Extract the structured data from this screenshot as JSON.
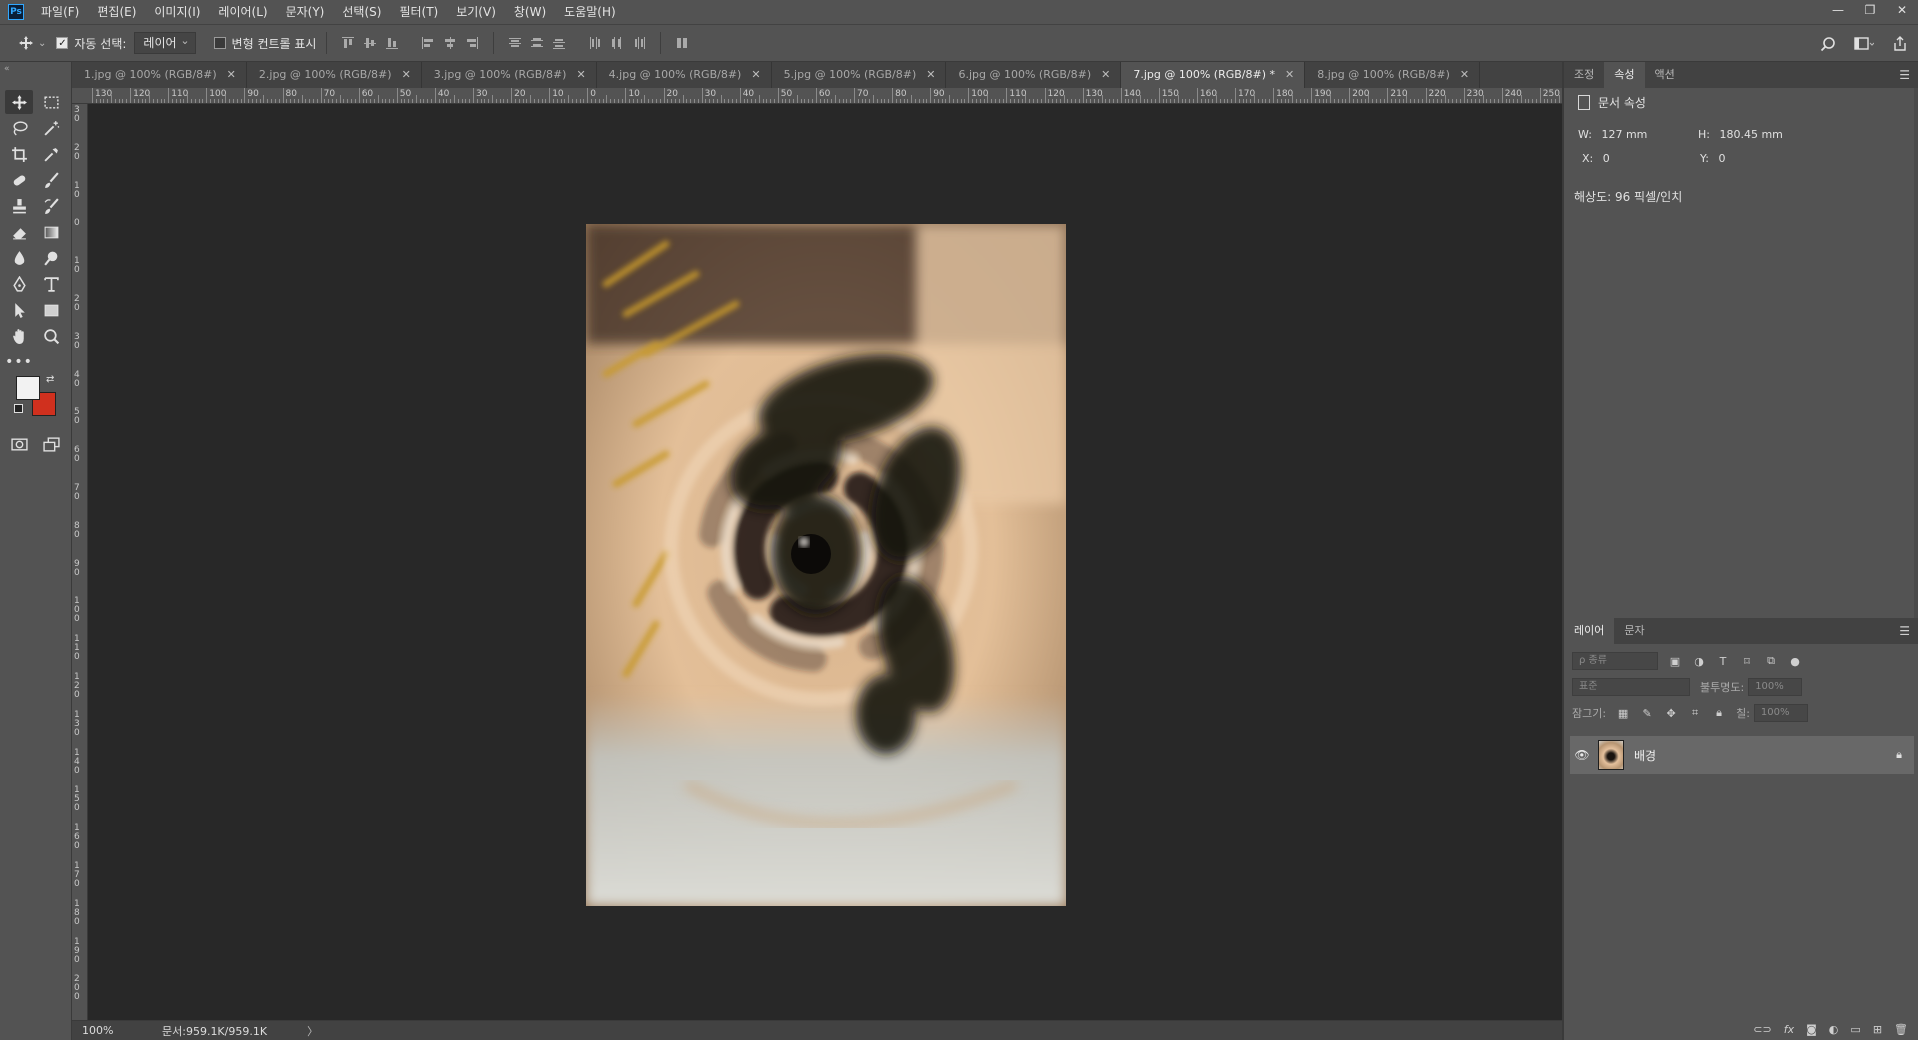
{
  "app": {
    "logo": "Ps"
  },
  "menubar": {
    "items": [
      "파일(F)",
      "편집(E)",
      "이미지(I)",
      "레이어(L)",
      "문자(Y)",
      "선택(S)",
      "필터(T)",
      "보기(V)",
      "창(W)",
      "도움말(H)"
    ]
  },
  "window_controls": {
    "minimize": "—",
    "restore": "❐",
    "close": "✕"
  },
  "options": {
    "auto_select_label": "자동 선택:",
    "auto_select_value": "레이어",
    "transform_controls_label": "변형 컨트롤 표시"
  },
  "tabs": [
    {
      "label": "1.jpg @ 100% (RGB/8#)"
    },
    {
      "label": "2.jpg @ 100% (RGB/8#)"
    },
    {
      "label": "3.jpg @ 100% (RGB/8#)"
    },
    {
      "label": "4.jpg @ 100% (RGB/8#)"
    },
    {
      "label": "5.jpg @ 100% (RGB/8#)"
    },
    {
      "label": "6.jpg @ 100% (RGB/8#)"
    },
    {
      "label": "7.jpg @ 100% (RGB/8#) *",
      "active": true
    },
    {
      "label": "8.jpg @ 100% (RGB/8#)"
    }
  ],
  "ruler_h_labels": [
    "130",
    "120",
    "110",
    "100",
    "90",
    "80",
    "70",
    "60",
    "50",
    "40",
    "30",
    "20",
    "10",
    "0",
    "10",
    "20",
    "30",
    "40",
    "50",
    "60",
    "70",
    "80",
    "90",
    "100",
    "110",
    "120",
    "130",
    "140",
    "150",
    "160",
    "170",
    "180",
    "190",
    "200",
    "210",
    "220",
    "230",
    "240",
    "250"
  ],
  "ruler_v_labels": [
    "3\n0",
    "2\n0",
    "1\n0",
    "0",
    "1\n0",
    "2\n0",
    "3\n0",
    "4\n0",
    "5\n0",
    "6\n0",
    "7\n0",
    "8\n0",
    "9\n0",
    "1\n0\n0",
    "1\n1\n0",
    "1\n2\n0",
    "1\n3\n0",
    "1\n4\n0",
    "1\n5\n0",
    "1\n6\n0",
    "1\n7\n0",
    "1\n8\n0",
    "1\n9\n0",
    "2\n0\n0"
  ],
  "status": {
    "zoom": "100%",
    "doc_size": "문서:959.1K/959.1K",
    "arrow": "〉"
  },
  "colors": {
    "foreground": "#f2f2f2",
    "background": "#d0301e",
    "accent": "#31a8ff"
  },
  "properties": {
    "tabs": [
      {
        "label": "조정"
      },
      {
        "label": "속성",
        "active": true
      },
      {
        "label": "액션"
      }
    ],
    "header": "문서 속성",
    "w_label": "W:",
    "w_value": "127 mm",
    "h_label": "H:",
    "h_value": "180.45 mm",
    "x_label": "X:",
    "x_value": "0",
    "y_label": "Y:",
    "y_value": "0",
    "resolution": "해상도: 96 픽셀/인치"
  },
  "layers": {
    "tabs": [
      {
        "label": "레이어",
        "active": true
      },
      {
        "label": "문자"
      }
    ],
    "filter_placeholder": "ρ 종류",
    "blend_mode": "표준",
    "opacity_label": "불투명도:",
    "opacity_value": "100%",
    "lock_label": "잠그기:",
    "fill_label": "칠:",
    "fill_value": "100%",
    "items": [
      {
        "name": "배경",
        "visible": true,
        "locked": true
      }
    ],
    "footer_icons": [
      "link-icon",
      "fx-icon",
      "mask-icon",
      "adjustment-icon",
      "folder-icon",
      "new-layer-icon",
      "trash-icon"
    ]
  }
}
